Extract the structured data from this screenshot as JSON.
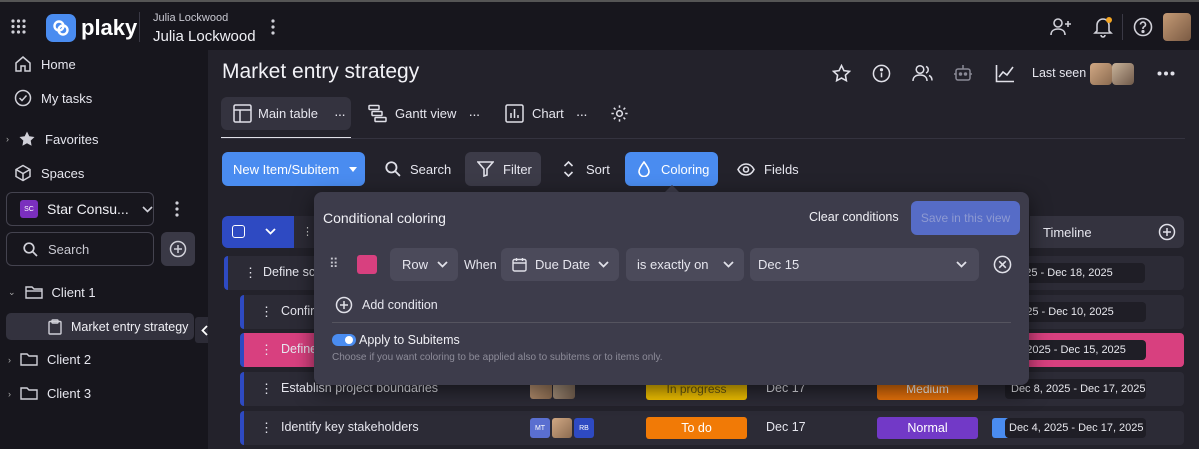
{
  "app": {
    "brand": "plaky",
    "workspace_small": "Julia Lockwood",
    "workspace_name": "Julia Lockwood"
  },
  "sidebar": {
    "home": "Home",
    "my_tasks": "My tasks",
    "favorites": "Favorites",
    "spaces": "Spaces",
    "space_badge": "SC",
    "space_name": "Star Consu...",
    "search_placeholder": "Search",
    "folders": [
      "Client 1",
      "Client 2",
      "Client 3"
    ],
    "active_board": "Market entry strategy"
  },
  "board": {
    "title": "Market entry strategy",
    "last_seen": "Last seen",
    "views": [
      "Main table",
      "Gantt view",
      "Chart"
    ]
  },
  "toolbar": {
    "new_item": "New Item/Subitem",
    "search": "Search",
    "filter": "Filter",
    "sort": "Sort",
    "coloring": "Coloring",
    "fields": "Fields"
  },
  "table": {
    "timeline_header": "Timeline",
    "rows": [
      {
        "name": "Define sco",
        "timeline": "2025 - Dec 18, 2025"
      },
      {
        "name": "Confir",
        "timeline": "2025 - Dec 10, 2025"
      },
      {
        "name": "Define",
        "timeline": "3, 2025 - Dec 15, 2025"
      },
      {
        "name": "Establish project boundaries",
        "status": "In progress",
        "date": "Dec 17",
        "priority": "Medium",
        "timeline": "Dec 8, 2025 - Dec 17, 2025"
      },
      {
        "name": "Identify key stakeholders",
        "assignee_badges": [
          "MT",
          "RB"
        ],
        "status": "To do",
        "date": "Dec 17",
        "priority": "Normal",
        "timeline": "Dec 4, 2025 - Dec 17, 2025"
      }
    ]
  },
  "coloring_popup": {
    "title": "Conditional coloring",
    "clear": "Clear conditions",
    "save": "Save in this view",
    "apply_to": "Row",
    "when": "When",
    "field": "Due Date",
    "operator": "is exactly on",
    "value": "Dec 15",
    "add_condition": "Add condition",
    "apply_subitems": "Apply to Subitems",
    "apply_hint": "Choose if you want coloring to be applied also to subitems or to items only."
  },
  "colors": {
    "accent": "#4a8cf0",
    "pink": "#d8407f",
    "orange": "#f17a06",
    "yellow": "#f2c200",
    "purple": "#7239c7",
    "medium_orange": "#e8720b"
  }
}
